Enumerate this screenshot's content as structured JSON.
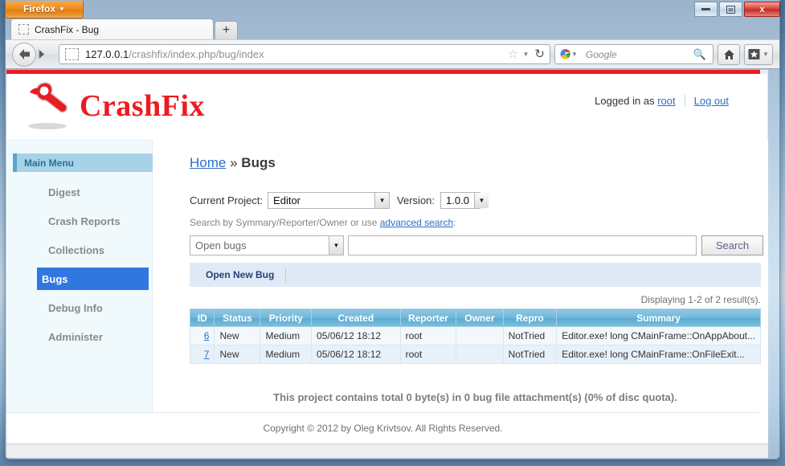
{
  "browser": {
    "app_button": "Firefox",
    "tab": {
      "title": "CrashFix - Bug"
    },
    "new_tab_label": "+",
    "url": {
      "host": "127.0.0.1",
      "path": "/crashfix/index.php/bug/index"
    },
    "search": {
      "engine": "Google",
      "value": ""
    },
    "window_controls": {
      "minimize": "–",
      "maximize": "□",
      "close": "x"
    }
  },
  "site": {
    "logo_text": "CrashFix",
    "logged_in_prefix": "Logged in as",
    "user": "root",
    "logout": "Log out"
  },
  "sidebar": {
    "title": "Main Menu",
    "items": [
      {
        "label": "Digest",
        "active": false
      },
      {
        "label": "Crash Reports",
        "active": false
      },
      {
        "label": "Collections",
        "active": false
      },
      {
        "label": "Bugs",
        "active": true
      },
      {
        "label": "Debug Info",
        "active": false
      },
      {
        "label": "Administer",
        "active": false
      }
    ]
  },
  "breadcrumb": {
    "home": "Home",
    "separator": "»",
    "current": "Bugs"
  },
  "filters": {
    "project_label": "Current Project:",
    "project_value": "Editor",
    "version_label": "Version:",
    "version_value": "1.0.0",
    "hint_prefix": "Search by Symmary/Reporter/Owner or use ",
    "hint_link": "advanced search",
    "hint_suffix": ":",
    "scope_value": "Open bugs",
    "search_value": "",
    "search_button": "Search"
  },
  "actions": {
    "open_new_bug": "Open New Bug"
  },
  "results": {
    "count_text": "Displaying 1-2 of 2 result(s).",
    "columns": [
      "ID",
      "Status",
      "Priority",
      "Created",
      "Reporter",
      "Owner",
      "Repro",
      "Summary"
    ],
    "rows": [
      {
        "id": "6",
        "status": "New",
        "priority": "Medium",
        "created": "05/06/12 18:12",
        "reporter": "root",
        "owner": "",
        "repro": "NotTried",
        "summary": "Editor.exe! long CMainFrame::OnAppAbout..."
      },
      {
        "id": "7",
        "status": "New",
        "priority": "Medium",
        "created": "05/06/12 18:12",
        "reporter": "root",
        "owner": "",
        "repro": "NotTried",
        "summary": "Editor.exe! long CMainFrame::OnFileExit..."
      }
    ]
  },
  "quota_note": "This project contains total 0 byte(s) in 0 bug file attachment(s) (0% of disc quota).",
  "footer": "Copyright © 2012 by Oleg Krivtsov. All Rights Reserved.",
  "colors": {
    "accent_red": "#ec1c24",
    "link_blue": "#2b6ecb",
    "active_menu_blue": "#3177e0",
    "table_header_blue": "#6fb6da",
    "sidebar_bg": "#f0fafd"
  }
}
